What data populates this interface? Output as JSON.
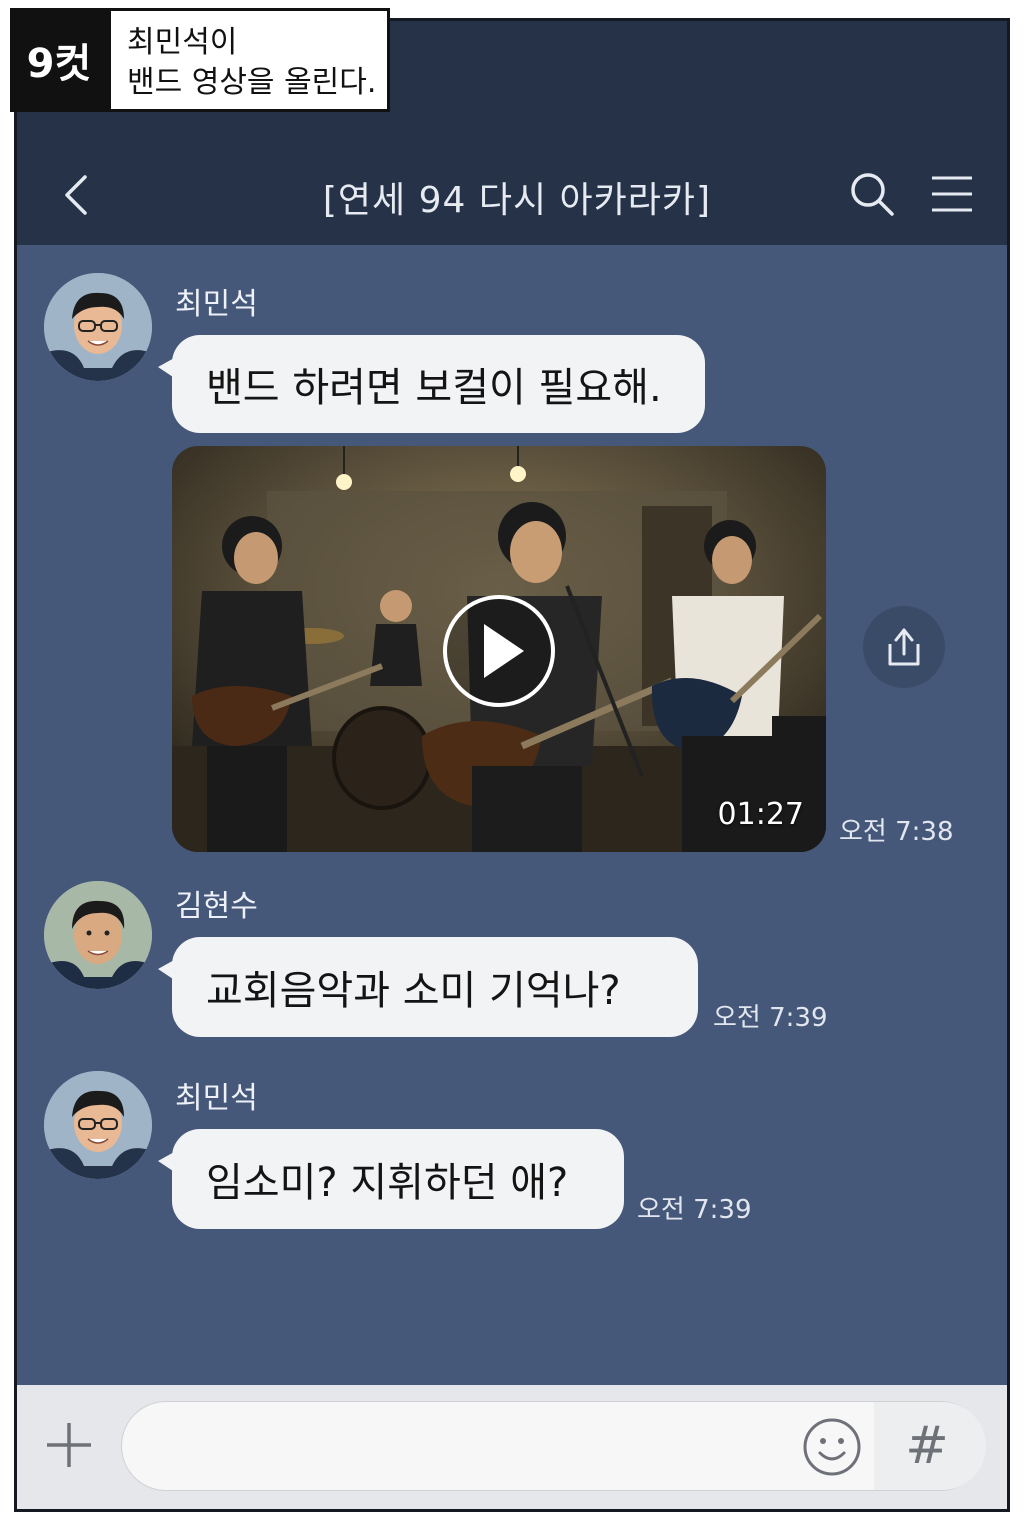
{
  "cut": {
    "number": "9컷",
    "caption_line1": "최민석이",
    "caption_line2": "밴드 영상을 올린다."
  },
  "header": {
    "title": "[연세 94 다시 아카라카]",
    "icons": [
      "back-icon",
      "search-icon",
      "menu-icon"
    ]
  },
  "messages": [
    {
      "sender": "최민석",
      "text": "밴드 하려면 보컬이 필요해."
    },
    {
      "sender": "최민석",
      "type": "video",
      "duration": "01:27",
      "time": "오전 7:38"
    },
    {
      "sender": "김현수",
      "text": "교회음악과 소미 기억나?",
      "time": "오전 7:39"
    },
    {
      "sender": "최민석",
      "text": "임소미? 지휘하던 애?",
      "time": "오전 7:39"
    }
  ],
  "input": {
    "placeholder": "",
    "icons": [
      "plus-icon",
      "emoji-icon",
      "hash-icon"
    ],
    "hash": "#"
  },
  "colors": {
    "chat_background": "#46587a",
    "header_background": "#263248",
    "bubble": "#f2f3f5"
  }
}
